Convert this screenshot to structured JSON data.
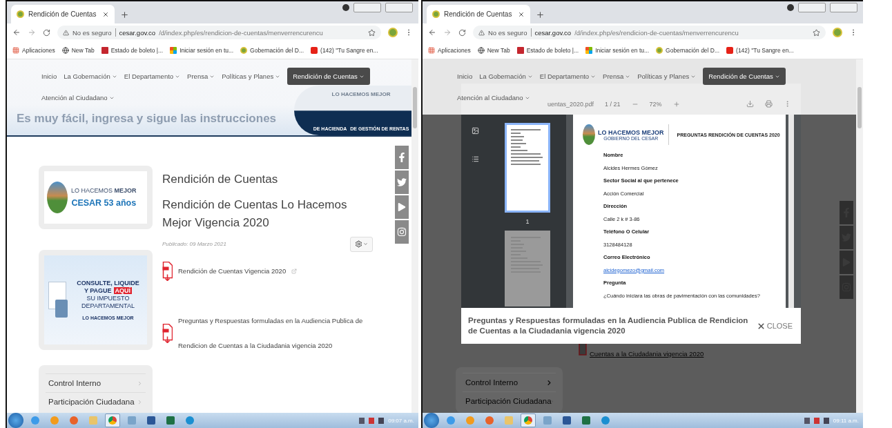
{
  "screens": [
    {
      "kind": "site",
      "tab": {
        "title": "Rendición de Cuentas",
        "selected": true
      },
      "address": {
        "security": "No es seguro",
        "host": "cesar.gov.co",
        "path": "/d/index.php/es/rendicion-de-cuentas/menverrencurencu"
      },
      "bookmarks": [
        {
          "kind": "apps",
          "label": "Aplicaciones"
        },
        {
          "kind": "globe",
          "label": "New Tab"
        },
        {
          "kind": "ticket",
          "label": "Estado de boleto |..."
        },
        {
          "kind": "windows",
          "label": "Iniciar sesión en tu..."
        },
        {
          "kind": "seal",
          "label": "Gobernación del D..."
        },
        {
          "kind": "video",
          "label": "(142) \"Tu Sangre en..."
        }
      ],
      "nav": [
        {
          "label": "Inicio",
          "dropdown": false,
          "selected": false
        },
        {
          "label": "La Gobernación",
          "dropdown": true,
          "selected": false
        },
        {
          "label": "El Departamento",
          "dropdown": true,
          "selected": false
        },
        {
          "label": "Prensa",
          "dropdown": true,
          "selected": false
        },
        {
          "label": "Políticas y Planes",
          "dropdown": true,
          "selected": false
        },
        {
          "label": "Rendición de Cuentas",
          "dropdown": true,
          "selected": true
        },
        {
          "label": "Atención al Ciudadano",
          "dropdown": true,
          "selected": false
        }
      ],
      "page": {
        "banner": {
          "title": "Es muy fácil, ingresa y sigue las instrucciones",
          "logo_text": "LO HACEMOS MEJOR",
          "caption": [
            "DE HACIENDA",
            "DE GESTIÓN DE RENTAS"
          ]
        },
        "promo": {
          "line1": "LO HACEMOS **MEJOR**",
          "line2": "CESAR 53 años"
        },
        "ad": {
          "lines": [
            "CONSULTE, LIQUIDE",
            "Y PAGUE"
          ],
          "highlight": "AQUÍ",
          "lines2": [
            "SU IMPUESTO",
            "DEPARTAMENTAL"
          ],
          "brand": "LO HACEMOS MEJOR"
        },
        "sidebar_menu": [
          "Control Interno",
          "Participación Ciudadana"
        ],
        "article": {
          "title": "Rendición de Cuentas",
          "subtitle": "Rendición de Cuentas Lo Hacemos Mejor Vigencia 2020",
          "published": "Publicado: 09 Marzo 2021",
          "attachments": [
            "Rendición de Cuentas Vigencia 2020",
            "Preguntas y Respuestas formuladas en la Audiencia Publica de Rendicion de Cuentas a la Ciudadania vigencia 2020"
          ]
        }
      },
      "taskbar": {
        "items": [
          {
            "kind": "ie",
            "selected": false
          },
          {
            "kind": "media",
            "selected": false
          },
          {
            "kind": "firefox",
            "selected": false
          },
          {
            "kind": "folder",
            "selected": false
          },
          {
            "kind": "chrome",
            "selected": true
          },
          {
            "kind": "installer",
            "selected": false
          },
          {
            "kind": "word",
            "selected": false
          },
          {
            "kind": "excel",
            "selected": false
          },
          {
            "kind": "edge",
            "selected": false
          }
        ],
        "clock": "09:07 a.m."
      }
    },
    {
      "kind": "viewer",
      "tab": {
        "title": "Rendición de Cuentas",
        "selected": true
      },
      "address": {
        "security": "No es seguro",
        "host": "cesar.gov.co",
        "path": "/d/index.php/es/rendicion-de-cuentas/menverrencurencu"
      },
      "bookmarks": [
        {
          "kind": "apps",
          "label": "Aplicaciones"
        },
        {
          "kind": "globe",
          "label": "New Tab"
        },
        {
          "kind": "ticket",
          "label": "Estado de boleto |..."
        },
        {
          "kind": "windows",
          "label": "Iniciar sesión en tu..."
        },
        {
          "kind": "seal",
          "label": "Gobernación del D..."
        },
        {
          "kind": "video",
          "label": "(142) \"Tu Sangre en..."
        }
      ],
      "nav": [
        {
          "label": "Inicio",
          "dropdown": false,
          "selected": false
        },
        {
          "label": "La Gobernación",
          "dropdown": true,
          "selected": false
        },
        {
          "label": "El Departamento",
          "dropdown": true,
          "selected": false
        },
        {
          "label": "Prensa",
          "dropdown": true,
          "selected": false
        },
        {
          "label": "Políticas y Planes",
          "dropdown": true,
          "selected": false
        },
        {
          "label": "Rendición de Cuentas",
          "dropdown": true,
          "selected": true
        },
        {
          "label": "Atención al Ciudadano",
          "dropdown": true,
          "selected": false
        }
      ],
      "page": {
        "link": "Cuentas a la Ciudadania vigencia 2020",
        "sidebar_menu": [
          "Control Interno",
          "Participación Ciudadana"
        ]
      },
      "viewer": {
        "file": "uentas_2020.pdf",
        "page_indicator": "1 / 21",
        "zoom": "72%",
        "thumbnails": [
          {
            "label": "1",
            "selected": true
          },
          {
            "selected": false
          }
        ],
        "document": {
          "brand": "LO HACEMOS MEJOR",
          "brand_sub": "GOBIERNO DEL CESAR",
          "title": "PREGUNTAS RENDICIÓN DE CUENTAS 2020",
          "fields": [
            {
              "kind": "text",
              "label": "Nombre",
              "value": "Alcides Hermes Gómez"
            },
            {
              "kind": "text",
              "label": "Sector Social al que pertenece",
              "value": "Acción Comercial"
            },
            {
              "kind": "text",
              "label": "Dirección",
              "value": "Calle 2 k # 3-86"
            },
            {
              "kind": "text",
              "label": "Teléfono O Celular",
              "value": "3128484128"
            },
            {
              "kind": "email",
              "label": "Correo Electrónico",
              "value": "alcidegomezo@gmail.com"
            },
            {
              "kind": "text",
              "label": "Pregunta",
              "value": "¿Cuándo iniciara las obras de pavimentación con las comunidades?"
            }
          ]
        },
        "caption": "Preguntas y Respuestas formuladas en la Audiencia Publica de Rendicion de Cuentas a la Ciudadania vigencia 2020",
        "close": "CLOSE"
      },
      "taskbar": {
        "items": [
          {
            "kind": "ie",
            "selected": false
          },
          {
            "kind": "media",
            "selected": false
          },
          {
            "kind": "firefox",
            "selected": false
          },
          {
            "kind": "folder",
            "selected": false
          },
          {
            "kind": "chrome",
            "selected": true
          },
          {
            "kind": "installer",
            "selected": false
          },
          {
            "kind": "word",
            "selected": false
          },
          {
            "kind": "excel",
            "selected": false
          },
          {
            "kind": "edge",
            "selected": false
          }
        ],
        "clock": "09:11 a.m."
      }
    }
  ]
}
